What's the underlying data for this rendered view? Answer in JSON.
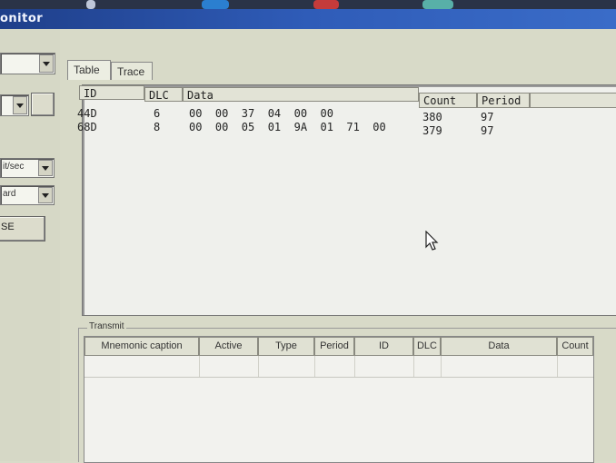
{
  "window": {
    "title": "onitor"
  },
  "left_panel": {
    "bitrate_unit": "it/sec",
    "mode": "ard",
    "action_button_label": "SE"
  },
  "tabs": [
    {
      "label": "Table",
      "active": true
    },
    {
      "label": "Trace",
      "active": false
    }
  ],
  "receive_table": {
    "columns": {
      "id": "ID",
      "dlc": "DLC",
      "data": "Data",
      "count": "Count",
      "period": "Period"
    },
    "rows": [
      {
        "id": "44D",
        "dlc": "6",
        "data": "00  00  37  04  00  00",
        "count": "380",
        "period": "97"
      },
      {
        "id": "68D",
        "dlc": "8",
        "data": "00  00  05  01  9A  01  71  00",
        "count": "379",
        "period": "97"
      }
    ]
  },
  "transmit": {
    "label": "Transmit",
    "columns": [
      "Mnemonic caption",
      "Active",
      "Type",
      "Period",
      "ID",
      "DLC",
      "Data",
      "Count"
    ]
  }
}
